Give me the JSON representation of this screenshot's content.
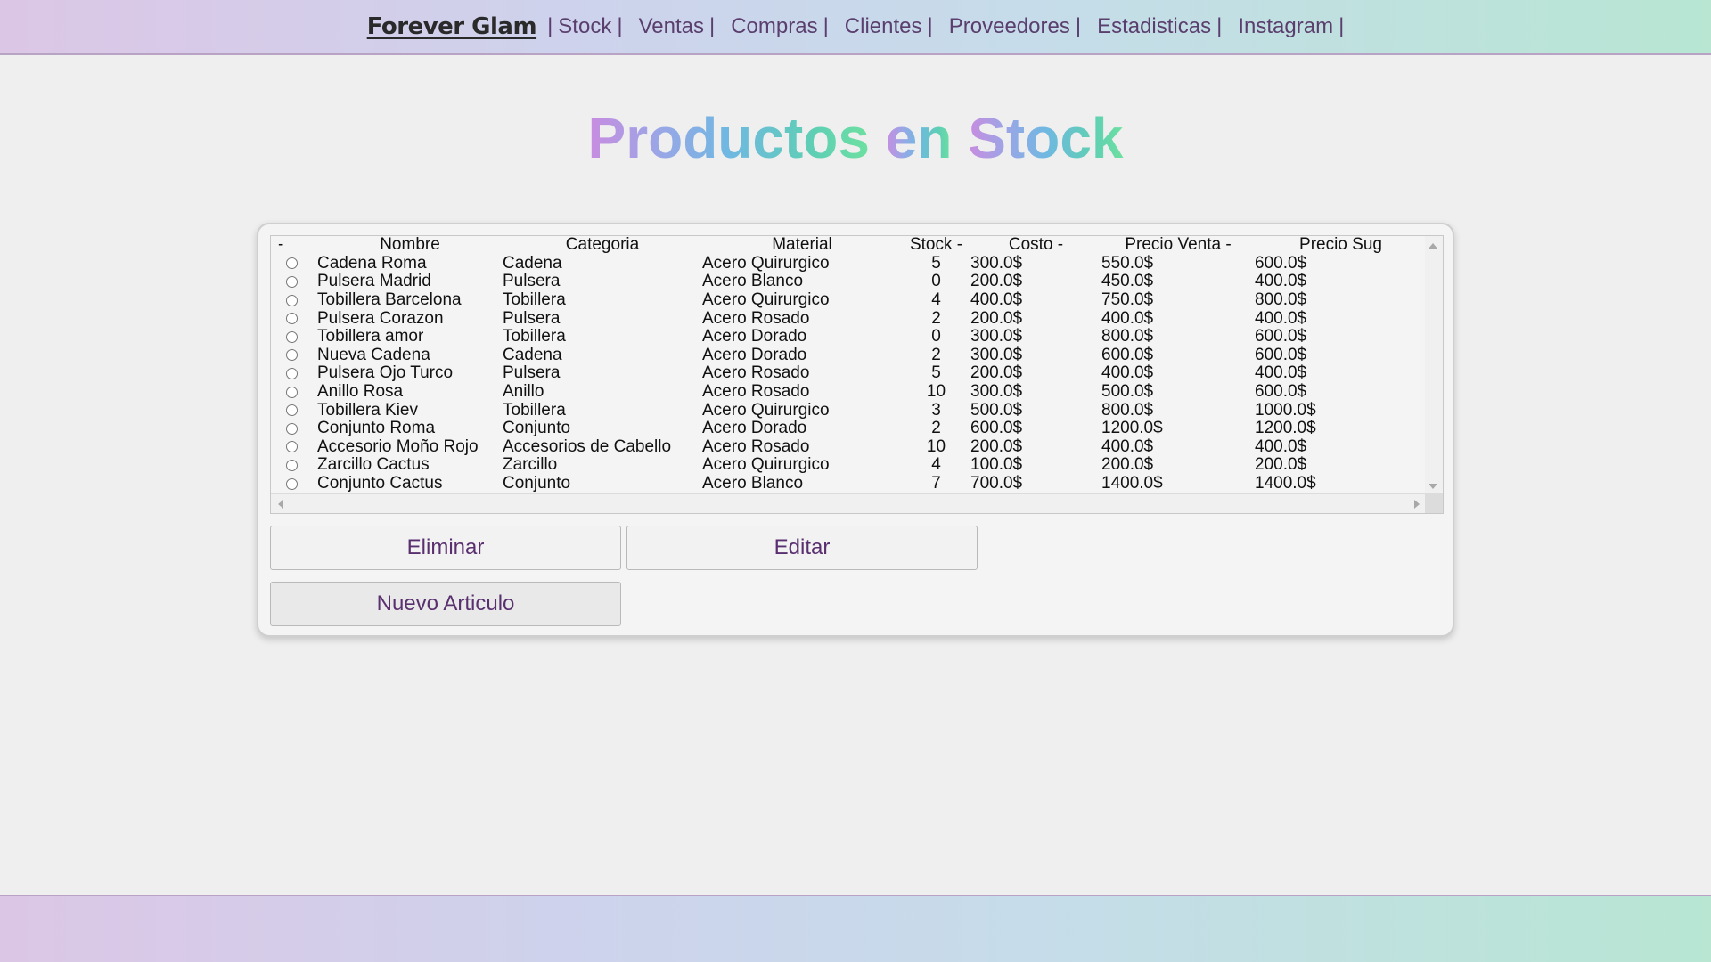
{
  "nav": {
    "brand": "Forever Glam",
    "items": [
      {
        "label": "Stock"
      },
      {
        "label": "Ventas"
      },
      {
        "label": "Compras"
      },
      {
        "label": "Clientes"
      },
      {
        "label": "Proveedores"
      },
      {
        "label": "Estadisticas"
      },
      {
        "label": "Instagram"
      }
    ],
    "separator": "|"
  },
  "page": {
    "title_words": [
      "Productos",
      "en",
      "Stock"
    ]
  },
  "table": {
    "headers": [
      "-",
      "Nombre",
      "Categoria",
      "Material",
      "Stock -",
      "Costo -",
      "Precio Venta -",
      "Precio Sug"
    ],
    "rows": [
      [
        "Cadena Roma",
        "Cadena",
        "Acero Quirurgico",
        "5",
        "300.0$",
        "550.0$",
        "600.0$"
      ],
      [
        "Pulsera Madrid",
        "Pulsera",
        "Acero Blanco",
        "0",
        "200.0$",
        "450.0$",
        "400.0$"
      ],
      [
        "Tobillera Barcelona",
        "Tobillera",
        "Acero Quirurgico",
        "4",
        "400.0$",
        "750.0$",
        "800.0$"
      ],
      [
        "Pulsera Corazon",
        "Pulsera",
        "Acero Rosado",
        "2",
        "200.0$",
        "400.0$",
        "400.0$"
      ],
      [
        "Tobillera amor",
        "Tobillera",
        "Acero Dorado",
        "0",
        "300.0$",
        "800.0$",
        "600.0$"
      ],
      [
        "Nueva Cadena",
        "Cadena",
        "Acero Dorado",
        "2",
        "300.0$",
        "600.0$",
        "600.0$"
      ],
      [
        "Pulsera Ojo Turco",
        "Pulsera",
        "Acero Rosado",
        "5",
        "200.0$",
        "400.0$",
        "400.0$"
      ],
      [
        "Anillo Rosa",
        "Anillo",
        "Acero Rosado",
        "10",
        "300.0$",
        "500.0$",
        "600.0$"
      ],
      [
        "Tobillera Kiev",
        "Tobillera",
        "Acero Quirurgico",
        "3",
        "500.0$",
        "800.0$",
        "1000.0$"
      ],
      [
        "Conjunto Roma",
        "Conjunto",
        "Acero Dorado",
        "2",
        "600.0$",
        "1200.0$",
        "1200.0$"
      ],
      [
        "Accesorio Moño Rojo",
        "Accesorios de Cabello",
        "Acero Rosado",
        "10",
        "200.0$",
        "400.0$",
        "400.0$"
      ],
      [
        "Zarcillo Cactus",
        "Zarcillo",
        "Acero Quirurgico",
        "4",
        "100.0$",
        "200.0$",
        "200.0$"
      ],
      [
        "Conjunto Cactus",
        "Conjunto",
        "Acero Blanco",
        "7",
        "700.0$",
        "1400.0$",
        "1400.0$"
      ]
    ]
  },
  "buttons": {
    "delete": "Eliminar",
    "edit": "Editar",
    "new_item": "Nuevo Articulo"
  }
}
